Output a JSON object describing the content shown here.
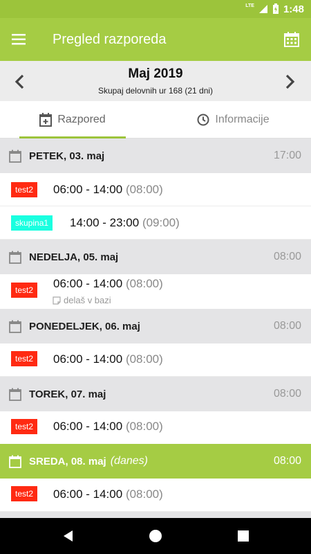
{
  "status_bar": {
    "network": "LTE",
    "time": "1:48"
  },
  "app_bar": {
    "title": "Pregled razporeda",
    "menu_icon": "hamburger-menu-icon",
    "calendar_icon": "calendar-grid-icon"
  },
  "month_nav": {
    "month": "Maj 2019",
    "summary": "Skupaj delovnih ur 168 (21 dni)"
  },
  "tabs": [
    {
      "label": "Razpored",
      "icon": "calendar-add-icon",
      "selected": true
    },
    {
      "label": "Informacije",
      "icon": "clock-icon",
      "selected": false
    }
  ],
  "colors": {
    "accent": "#a5cc44",
    "badge_red": "#ff2a12",
    "badge_cyan": "#1affe0"
  },
  "days": [
    {
      "label": "PETEK, 03. maj",
      "hours": "17:00",
      "today": false,
      "shifts": [
        {
          "group": "test2",
          "time": "06:00 - 14:00",
          "duration": "(08:00)"
        },
        {
          "group": "skupina1",
          "time": "14:00 - 23:00",
          "duration": "(09:00)"
        }
      ]
    },
    {
      "label": "NEDELJA, 05. maj",
      "hours": "08:00",
      "today": false,
      "shifts": [
        {
          "group": "test2",
          "time": "06:00 - 14:00",
          "duration": "(08:00)",
          "note": "delaš v bazi"
        }
      ]
    },
    {
      "label": "PONEDELJEK, 06. maj",
      "hours": "08:00",
      "today": false,
      "shifts": [
        {
          "group": "test2",
          "time": "06:00 - 14:00",
          "duration": "(08:00)"
        }
      ]
    },
    {
      "label": "TOREK, 07. maj",
      "hours": "08:00",
      "today": false,
      "shifts": [
        {
          "group": "test2",
          "time": "06:00 - 14:00",
          "duration": "(08:00)"
        }
      ]
    },
    {
      "label": "SREDA, 08. maj",
      "today_label": "(danes)",
      "hours": "08:00",
      "today": true,
      "shifts": [
        {
          "group": "test2",
          "time": "06:00 - 14:00",
          "duration": "(08:00)"
        }
      ]
    }
  ]
}
